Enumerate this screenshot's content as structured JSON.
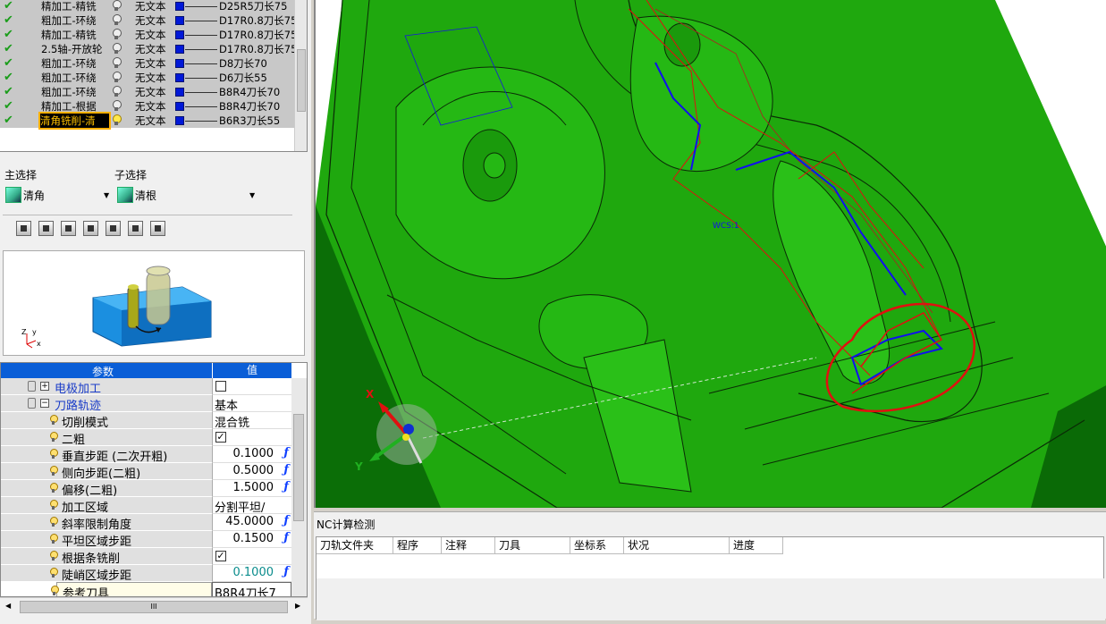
{
  "operations": [
    {
      "name": "精加工-精铣",
      "text": "无文本",
      "tool": "D25R5刀长75",
      "selected": false
    },
    {
      "name": "粗加工-环绕",
      "text": "无文本",
      "tool": "D17R0.8刀长75",
      "selected": false
    },
    {
      "name": "精加工-精铣",
      "text": "无文本",
      "tool": "D17R0.8刀长75",
      "selected": false
    },
    {
      "name": "2.5轴-开放轮",
      "text": "无文本",
      "tool": "D17R0.8刀长75",
      "selected": false
    },
    {
      "name": "粗加工-环绕",
      "text": "无文本",
      "tool": "D8刀长70",
      "selected": false
    },
    {
      "name": "粗加工-环绕",
      "text": "无文本",
      "tool": "D6刀长55",
      "selected": false
    },
    {
      "name": "粗加工-环绕",
      "text": "无文本",
      "tool": "B8R4刀长70",
      "selected": false
    },
    {
      "name": "精加工-根据",
      "text": "无文本",
      "tool": "B8R4刀长70",
      "selected": false
    },
    {
      "name": "清角铣削-清",
      "text": "无文本",
      "tool": "B6R3刀长55",
      "selected": true
    }
  ],
  "selection": {
    "main_label": "主选择",
    "main_value": "清角",
    "sub_label": "子选择",
    "sub_value": "清根"
  },
  "preview": {
    "axis_z": "Z",
    "axis_y": "y",
    "axis_x": "x"
  },
  "params": {
    "col_name": "参数",
    "col_value": "值",
    "rows": [
      {
        "label": "电极加工",
        "value": "",
        "kind": "checkbox",
        "checked": false,
        "group": true,
        "expander": "+"
      },
      {
        "label": "刀路轨迹",
        "value": "基本",
        "kind": "text",
        "group": true,
        "expander": "−"
      },
      {
        "label": "切削模式",
        "value": "混合铣",
        "kind": "text"
      },
      {
        "label": "二粗",
        "value": "",
        "kind": "checkbox",
        "checked": true
      },
      {
        "label": "垂直步距 (二次开粗)",
        "value": "0.1000",
        "kind": "num"
      },
      {
        "label": "侧向步距(二粗)",
        "value": "0.5000",
        "kind": "num"
      },
      {
        "label": "偏移(二粗)",
        "value": "1.5000",
        "kind": "num"
      },
      {
        "label": "加工区域",
        "value": "分割平坦/",
        "kind": "text"
      },
      {
        "label": "斜率限制角度",
        "value": "45.0000",
        "kind": "num"
      },
      {
        "label": "平坦区域步距",
        "value": "0.1500",
        "kind": "num"
      },
      {
        "label": "根据条铣削",
        "value": "",
        "kind": "checkbox",
        "checked": true
      },
      {
        "label": "陡峭区域步距",
        "value": "0.1000",
        "kind": "num",
        "teal": true
      },
      {
        "label": "参考刀具",
        "value": "B8R4刀长7",
        "kind": "text",
        "boxed": true
      }
    ]
  },
  "hscroll_grip": "III",
  "viewport": {
    "triad_x": "X",
    "triad_y": "Y",
    "csys_label": "WCS:1",
    "colors": {
      "part": "#1fa80e",
      "part_dark": "#0b6e07",
      "edge": "#0a2a06",
      "toolpath_red": "#e01010",
      "toolpath_blue": "#1010ee"
    }
  },
  "nc": {
    "title": "NC计算检测",
    "columns": [
      "刀轨文件夹",
      "程序",
      "注释",
      "刀具",
      "坐标系",
      "状况",
      "进度"
    ]
  }
}
